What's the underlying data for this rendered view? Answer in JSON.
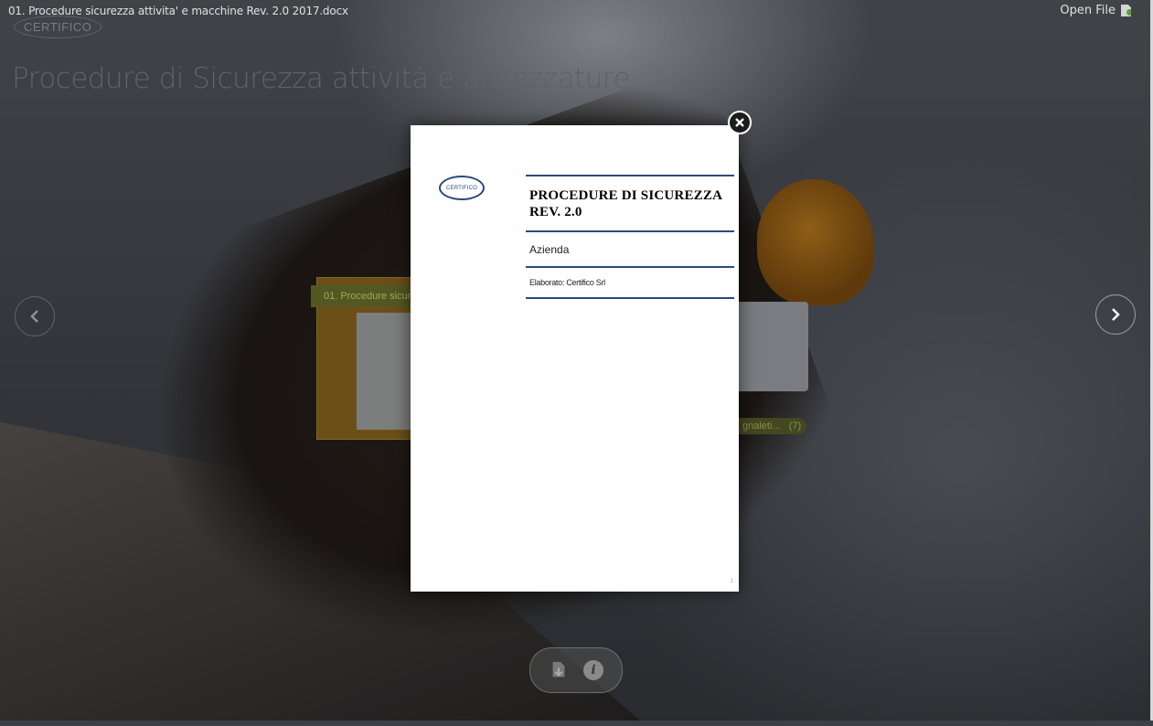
{
  "window": {
    "file_title": "01. Procedure sicurezza attivita' e macchine Rev. 2.0 2017.docx",
    "open_file_label": "Open File"
  },
  "background": {
    "brand_logo_text": "CERTIFICO",
    "collection_title": "Procedure di Sicurezza attività e attrezzature",
    "thumbnail_label": "01. Procedure sicurezza",
    "side_label": "gnaleti...",
    "side_count": "(7)"
  },
  "navigation": {
    "prev_icon": "chevron-left-icon",
    "next_icon": "chevron-right-icon"
  },
  "preview": {
    "logo_text": "CERTIFICO",
    "title_line1": "PROCEDURE DI SICUREZZA",
    "title_line2": "REV. 2.0",
    "company": "Azienda",
    "author": "Elaborato: Certifico Srl",
    "page_number": "1"
  },
  "toolbar": {
    "download_icon": "download-icon",
    "info_icon": "info-icon",
    "info_glyph": "i"
  },
  "colors": {
    "accent_rule": "#2c4a7a",
    "thumb_label_text": "#b7c064"
  }
}
